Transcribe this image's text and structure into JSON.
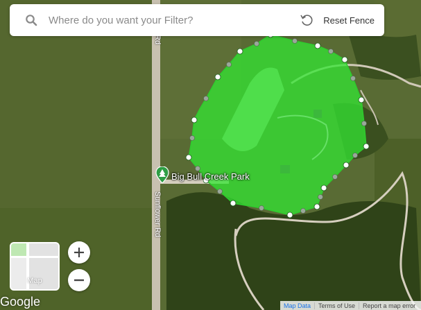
{
  "search": {
    "placeholder": "Where do you want your Filter?",
    "icon": "search-icon"
  },
  "reset": {
    "label": "Reset Fence",
    "icon": "reset-icon"
  },
  "map": {
    "place_name": "Big Bull Creek Park",
    "road_names": [
      "Sunflower Rd",
      "Rd"
    ],
    "fence_color": "#33e633",
    "vertex_color": "#ffffff"
  },
  "controls": {
    "layer_label": "Map",
    "zoom_in": "+",
    "zoom_out": "−"
  },
  "branding": {
    "logo": "Google"
  },
  "attribution": {
    "map_data": "Map Data",
    "terms": "Terms of Use",
    "report": "Report a map error"
  }
}
